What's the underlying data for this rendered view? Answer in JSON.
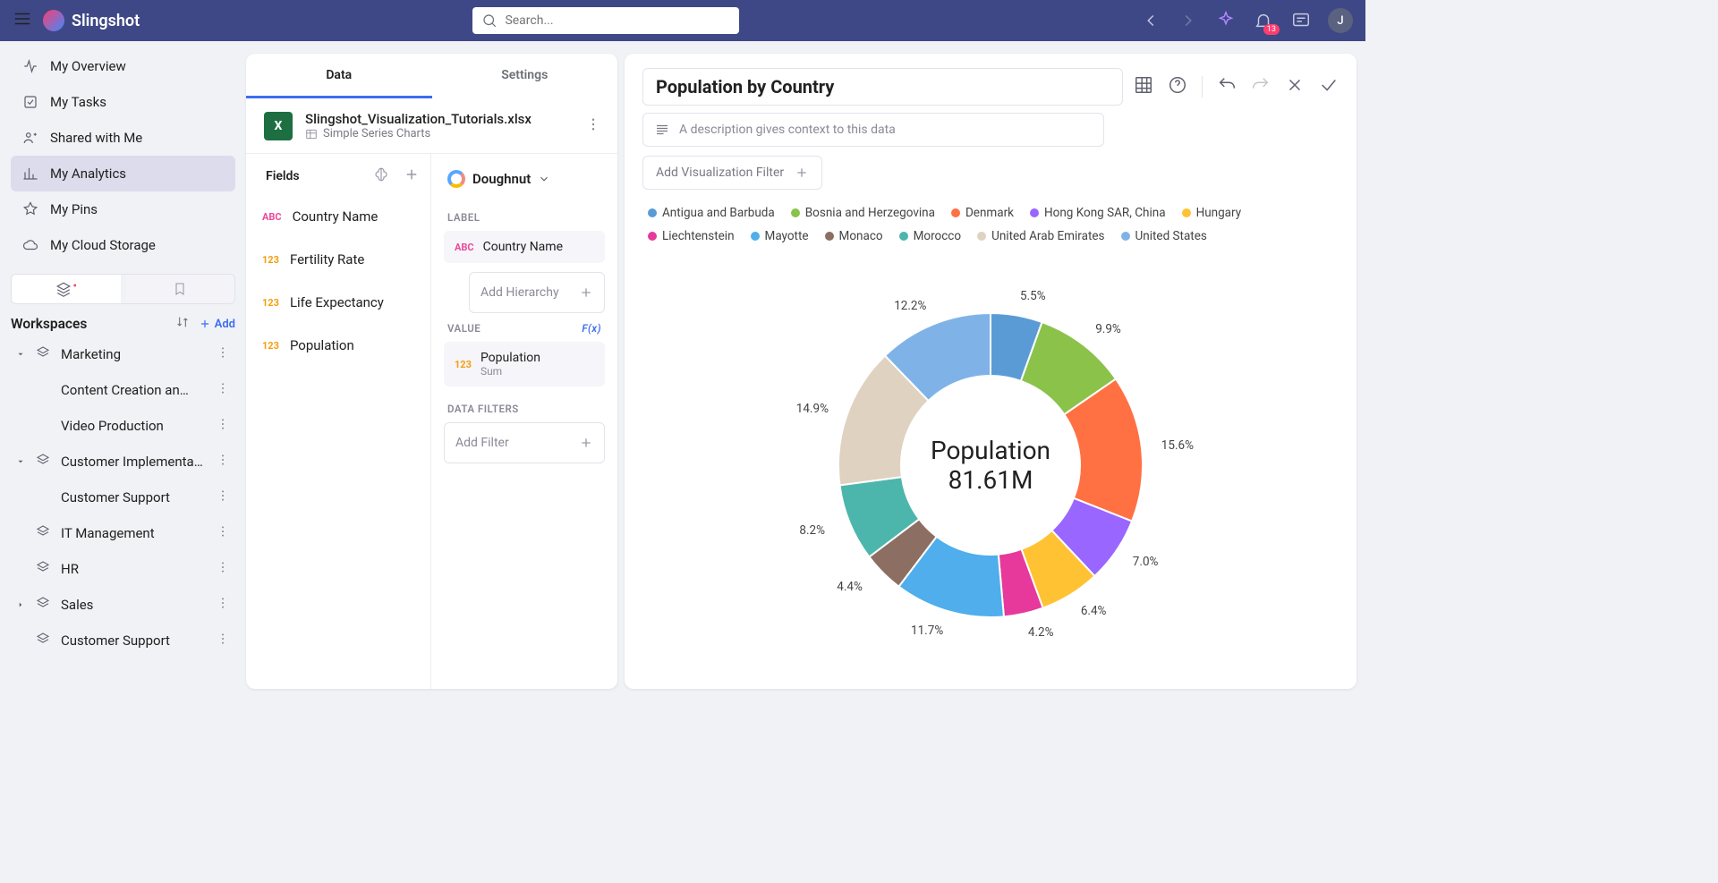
{
  "brand": "Slingshot",
  "search_placeholder": "Search...",
  "notif_count": "13",
  "avatar_initial": "J",
  "nav": [
    {
      "icon": "overview",
      "label": "My Overview"
    },
    {
      "icon": "tasks",
      "label": "My Tasks"
    },
    {
      "icon": "shared",
      "label": "Shared with Me"
    },
    {
      "icon": "analytics",
      "label": "My Analytics",
      "active": true
    },
    {
      "icon": "pins",
      "label": "My Pins"
    },
    {
      "icon": "cloud",
      "label": "My Cloud Storage"
    }
  ],
  "workspaces_label": "Workspaces",
  "add_label": "Add",
  "workspaces": [
    {
      "label": "Marketing",
      "expanded": true,
      "children": [
        "Content Creation an…",
        "Video Production"
      ]
    },
    {
      "label": "Customer Implementa…",
      "expanded": true,
      "children": [
        "Customer Support"
      ]
    },
    {
      "label": "IT Management"
    },
    {
      "label": "HR"
    },
    {
      "label": "Sales",
      "caret": true
    },
    {
      "label": "Customer Support"
    }
  ],
  "tabs": {
    "data": "Data",
    "settings": "Settings"
  },
  "file": {
    "name": "Slingshot_Visualization_Tutorials.xlsx",
    "sheet": "Simple Series Charts"
  },
  "fields_label": "Fields",
  "fields": [
    {
      "type": "abc",
      "name": "Country Name"
    },
    {
      "type": "123",
      "name": "Fertility Rate"
    },
    {
      "type": "123",
      "name": "Life Expectancy"
    },
    {
      "type": "123",
      "name": "Population"
    }
  ],
  "viz_type": "Doughnut",
  "sections": {
    "label": "LABEL",
    "value": "VALUE",
    "fx": "F(x)",
    "filters": "DATA FILTERS",
    "add_hierarchy": "Add Hierarchy",
    "add_filter": "Add Filter"
  },
  "label_chip": {
    "type": "abc",
    "name": "Country Name"
  },
  "value_chip": {
    "type": "123",
    "name": "Population",
    "agg": "Sum"
  },
  "viz": {
    "title": "Population by Country",
    "desc_placeholder": "A description gives context to this data",
    "add_filter": "Add Visualization Filter",
    "center_label": "Population",
    "center_value": "81.61M"
  },
  "chart_data": {
    "type": "pie",
    "title": "Population by Country",
    "center": "Population 81.61M",
    "series": [
      {
        "name": "Antigua and Barbuda",
        "pct": 5.5,
        "color": "#5B9BD5"
      },
      {
        "name": "Bosnia and Herzegovina",
        "pct": 9.9,
        "color": "#8BC34A"
      },
      {
        "name": "Denmark",
        "pct": 15.6,
        "color": "#FF7043"
      },
      {
        "name": "Hong Kong SAR, China",
        "pct": 7.0,
        "color": "#9966FF"
      },
      {
        "name": "Hungary",
        "pct": 6.4,
        "color": "#FFC233"
      },
      {
        "name": "Liechtenstein",
        "pct": 4.2,
        "color": "#E6399B"
      },
      {
        "name": "Mayotte",
        "pct": 11.7,
        "color": "#4FAEEB"
      },
      {
        "name": "Monaco",
        "pct": 4.4,
        "color": "#8D6E63"
      },
      {
        "name": "Morocco",
        "pct": 8.2,
        "color": "#4DB6AC"
      },
      {
        "name": "United Arab Emirates",
        "pct": 14.9,
        "color": "#E0D2C0"
      },
      {
        "name": "United States",
        "pct": 12.2,
        "color": "#7FB3E8"
      }
    ]
  }
}
